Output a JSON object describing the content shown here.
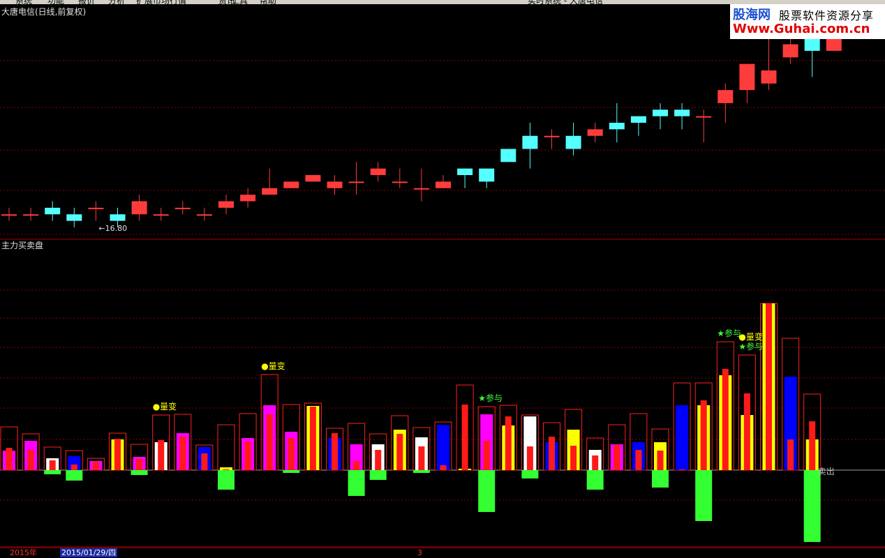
{
  "menubar": {
    "items": [
      "系统",
      "功能",
      "报价",
      "分析",
      "扩展市场行情",
      "资讯",
      "工具",
      "帮助"
    ],
    "title": "实时系统 - 大唐电信"
  },
  "logo": {
    "name": "股海网",
    "slogan": "股票软件资源分享",
    "url": "Www.Guhai.com.cn"
  },
  "main_panel": {
    "title": "大唐电信(日线,前复权)",
    "low_label": "←16.80"
  },
  "sub_panel": {
    "title": "主力买卖盘",
    "annotations": [
      {
        "text": "●量变",
        "bar": 7,
        "color": "#ffff00"
      },
      {
        "text": "●量变",
        "bar": 12,
        "color": "#ffff00"
      },
      {
        "text": "★参与",
        "bar": 22,
        "color": "#40ff40"
      },
      {
        "text": "★参与",
        "bar": 33,
        "color": "#40ff40"
      },
      {
        "text": "●量变",
        "bar": 34,
        "color": "#ffff00"
      },
      {
        "text": "★参与",
        "bar": 34,
        "color": "#40ff40"
      },
      {
        "text": "卖出",
        "bar": 37,
        "color": "#c0c0c0"
      }
    ]
  },
  "statusbar": {
    "year": "2015年",
    "date": "2015/01/29/四",
    "page": "3"
  },
  "colors": {
    "up": "#ff3c3c",
    "down": "#54ffff",
    "grid": "#8b0000"
  },
  "chart_data": [
    {
      "type": "candlestick",
      "title": "大唐电信(日线,前复权)",
      "annotations": [
        {
          "text": "←16.80",
          "bar": 4
        }
      ],
      "x": [
        1,
        2,
        3,
        4,
        5,
        6,
        7,
        8,
        9,
        10,
        11,
        12,
        13,
        14,
        15,
        16,
        17,
        18,
        19,
        20,
        21,
        22,
        23,
        24,
        25,
        26,
        27,
        28,
        29,
        30,
        31,
        32,
        33,
        34,
        35,
        36,
        37,
        38,
        39
      ],
      "open": [
        1,
        1,
        2,
        1,
        2,
        1,
        1,
        1,
        2,
        1,
        2,
        3,
        4,
        5,
        6,
        5,
        6,
        7,
        6,
        5,
        5,
        8,
        8,
        11,
        13,
        13,
        13,
        13,
        15,
        16,
        17,
        17,
        16,
        18,
        20,
        21,
        25,
        29,
        26
      ],
      "close": [
        1,
        1,
        1,
        0,
        2,
        0,
        3,
        1,
        2,
        1,
        3,
        4,
        5,
        6,
        7,
        6,
        6,
        8,
        6,
        5,
        6,
        7,
        6,
        9,
        11,
        13,
        11,
        14,
        14,
        15,
        16,
        16,
        16,
        20,
        24,
        23,
        27,
        26,
        29
      ],
      "high": [
        2,
        2,
        3,
        2,
        3,
        2,
        4,
        2,
        3,
        2,
        4,
        5,
        8,
        6,
        7,
        7,
        9,
        9,
        8,
        8,
        7,
        8,
        8,
        11,
        15,
        14,
        15,
        15,
        18,
        16,
        18,
        18,
        17,
        21,
        24,
        29,
        31,
        31,
        30
      ],
      "low": [
        0,
        0,
        0,
        -1,
        0,
        -1,
        0,
        0,
        1,
        0,
        1,
        2,
        4,
        5,
        6,
        4,
        4,
        6,
        5,
        3,
        5,
        5,
        5,
        9,
        8,
        11,
        10,
        12,
        12,
        13,
        14,
        14,
        12,
        15,
        18,
        20,
        24,
        22,
        28
      ]
    },
    {
      "type": "bar",
      "title": "主力买卖盘",
      "x": [
        1,
        2,
        3,
        4,
        5,
        6,
        7,
        8,
        9,
        10,
        11,
        12,
        13,
        14,
        15,
        16,
        17,
        18,
        19,
        20,
        21,
        22,
        23,
        24,
        25,
        26,
        27,
        28,
        29,
        30,
        31,
        32,
        33,
        34,
        35,
        36,
        37,
        38,
        39
      ],
      "outline": [
        62,
        52,
        33,
        28,
        17,
        53,
        37,
        79,
        80,
        36,
        65,
        81,
        137,
        94,
        96,
        60,
        67,
        52,
        78,
        61,
        69,
        122,
        91,
        93,
        79,
        68,
        87,
        46,
        65,
        81,
        59,
        125,
        125,
        184,
        165,
        239,
        189,
        109,
        0
      ],
      "wide": [
        28,
        42,
        17,
        20,
        13,
        44,
        19,
        40,
        53,
        33,
        4,
        46,
        93,
        55,
        92,
        46,
        37,
        37,
        58,
        47,
        65,
        2,
        80,
        64,
        77,
        40,
        58,
        29,
        37,
        40,
        40,
        93,
        93,
        136,
        79,
        239,
        134,
        44,
        0
      ],
      "wide_color": [
        "#ff00ff",
        "#ff00ff",
        "#ffffff",
        "#0000ff",
        "#ff00ff",
        "#ffff00",
        "#ff00ff",
        "#ffffff",
        "#ff00ff",
        "#0000ff",
        "#ffff00",
        "#ff00ff",
        "#ff00ff",
        "#ff00ff",
        "#ffff00",
        "#0000ff",
        "#ff00ff",
        "#ffffff",
        "#ffff00",
        "#ffffff",
        "#0000ff",
        "#ffff00",
        "#ff00ff",
        "#ffff00",
        "#ffffff",
        "#0000ff",
        "#ffff00",
        "#ffffff",
        "#ff00ff",
        "#0000ff",
        "#ffff00",
        "#0000ff",
        "#ffff00",
        "#ffff00",
        "#ffff00",
        "#ffff00",
        "#0000ff",
        "#ffff00",
        "#ffff00"
      ],
      "inner": [
        32,
        29,
        14,
        8,
        12,
        45,
        16,
        43,
        48,
        24,
        1,
        41,
        80,
        46,
        91,
        53,
        13,
        29,
        52,
        34,
        7,
        94,
        42,
        77,
        34,
        48,
        35,
        21,
        36,
        29,
        28,
        1,
        100,
        145,
        110,
        239,
        44,
        70,
        0
      ],
      "negative": [
        0,
        0,
        6,
        15,
        0,
        0,
        7,
        0,
        0,
        0,
        28,
        0,
        0,
        4,
        0,
        0,
        37,
        14,
        0,
        4,
        0,
        0,
        60,
        0,
        12,
        0,
        0,
        28,
        0,
        0,
        25,
        0,
        73,
        0,
        0,
        0,
        0,
        103,
        0
      ],
      "annotations": [
        "●量变",
        "●量变",
        "★参与",
        "★参与",
        "●量变",
        "★参与",
        "卖出"
      ]
    }
  ]
}
